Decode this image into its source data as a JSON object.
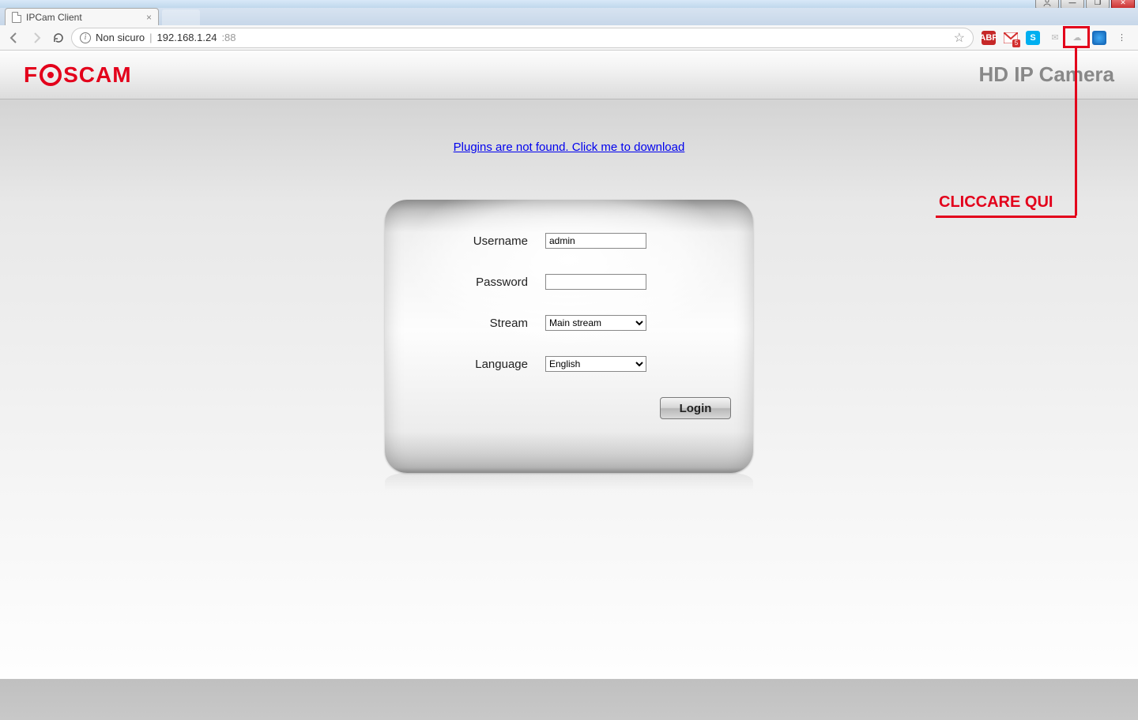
{
  "window": {
    "user_btn": "👤",
    "min_btn": "—",
    "max_btn": "❐",
    "close_btn": "✕"
  },
  "tab": {
    "title": "IPCam Client",
    "close": "×"
  },
  "addressbar": {
    "security_label": "Non sicuro",
    "host": "192.168.1.24",
    "port": ":88"
  },
  "extensions": {
    "abp": "ABP",
    "gmail_badge": "5",
    "skype": "S"
  },
  "banner": {
    "brand_prefix": "F",
    "brand_suffix": "SCAM",
    "product": "HD IP Camera"
  },
  "page": {
    "plugin_link": "Plugins are not found. Click me to download"
  },
  "form": {
    "username_label": "Username",
    "username_value": "admin",
    "password_label": "Password",
    "password_value": "",
    "stream_label": "Stream",
    "stream_value": "Main stream",
    "language_label": "Language",
    "language_value": "English",
    "login_button": "Login"
  },
  "annotation": {
    "label": "CLICCARE QUI"
  }
}
